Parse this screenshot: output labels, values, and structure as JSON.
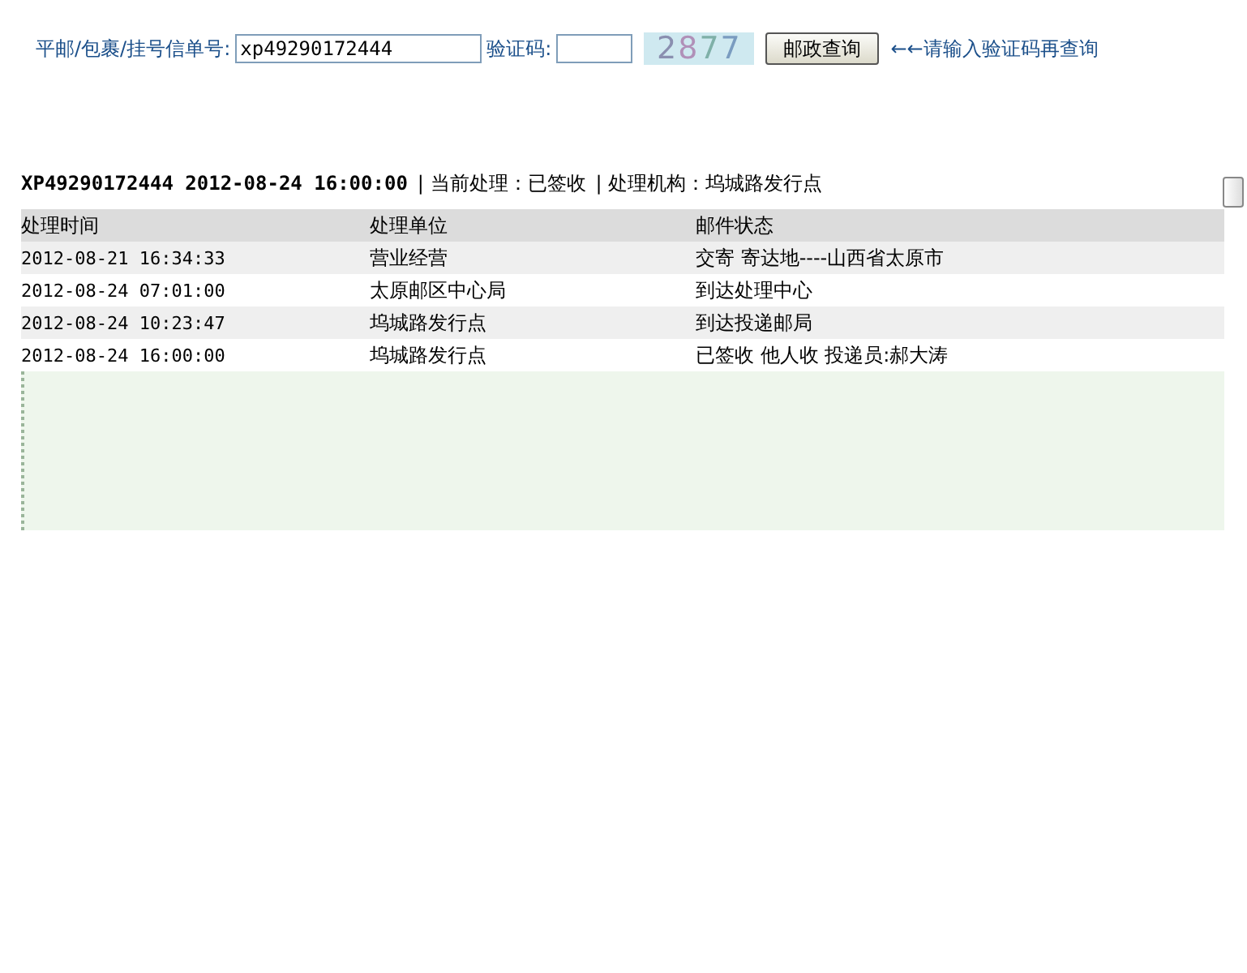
{
  "query": {
    "label": "平邮/包裹/挂号信单号:",
    "value": "xp49290172444",
    "captcha_label": "验证码:",
    "captcha": "2877",
    "button": "邮政查询",
    "hint": "←←请输入验证码再查询"
  },
  "summary": {
    "number": "XP49290172444 2012-08-24 16:00:00",
    "status": "| 当前处理：已签收",
    "office": "| 处理机构：坞城路发行点"
  },
  "table": {
    "columns": [
      "处理时间",
      "处理单位",
      "邮件状态"
    ],
    "rows": [
      {
        "cells": [
          "2012-08-21 16:34:33",
          "营业经营",
          "交寄 寄达地----山西省太原市"
        ]
      },
      {
        "cells": [
          "2012-08-24 07:01:00",
          "太原邮区中心局",
          "到达处理中心"
        ]
      },
      {
        "cells": [
          "2012-08-24 10:23:47",
          "坞城路发行点",
          "到达投递邮局"
        ]
      },
      {
        "cells": [
          "2012-08-24 16:00:00",
          "坞城路发行点",
          "已签收 他人收 投递员:郝大涛"
        ]
      }
    ]
  }
}
